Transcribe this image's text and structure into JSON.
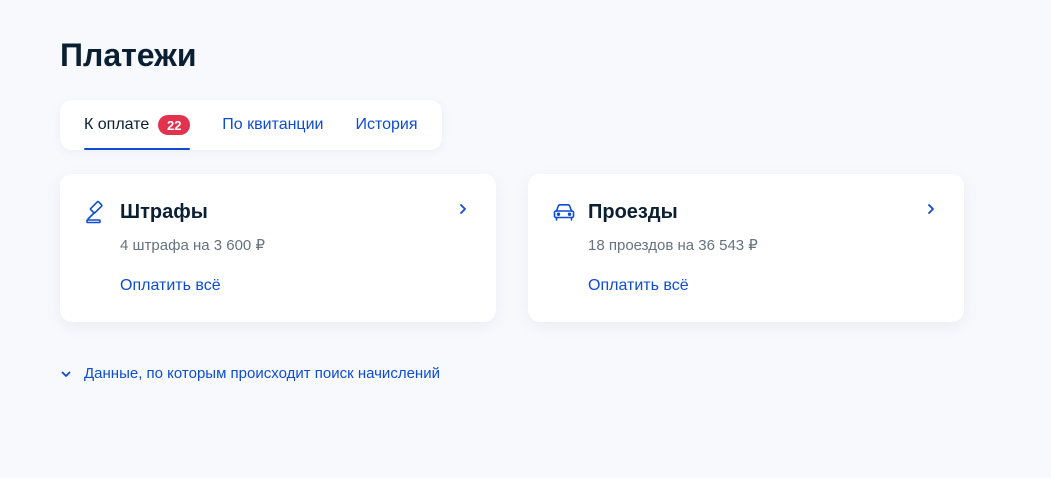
{
  "page": {
    "title": "Платежи"
  },
  "tabs": [
    {
      "label": "К оплате",
      "badge": "22",
      "active": true
    },
    {
      "label": "По квитанции",
      "active": false
    },
    {
      "label": "История",
      "active": false
    }
  ],
  "cards": [
    {
      "title": "Штрафы",
      "subtitle": "4 штрафа на 3 600 ₽",
      "action": "Оплатить всё",
      "icon": "gavel-icon"
    },
    {
      "title": "Проезды",
      "subtitle": "18 проездов на 36 543 ₽",
      "action": "Оплатить всё",
      "icon": "car-icon"
    }
  ],
  "disclosure": {
    "label": "Данные, по которым происходит поиск начислений",
    "icon": "chevron-down-icon"
  },
  "colors": {
    "accent": "#0d4cd3",
    "badge": "#e3324e",
    "background": "#f7f9fd",
    "text": "#0b1f33",
    "muted": "#66727f"
  }
}
